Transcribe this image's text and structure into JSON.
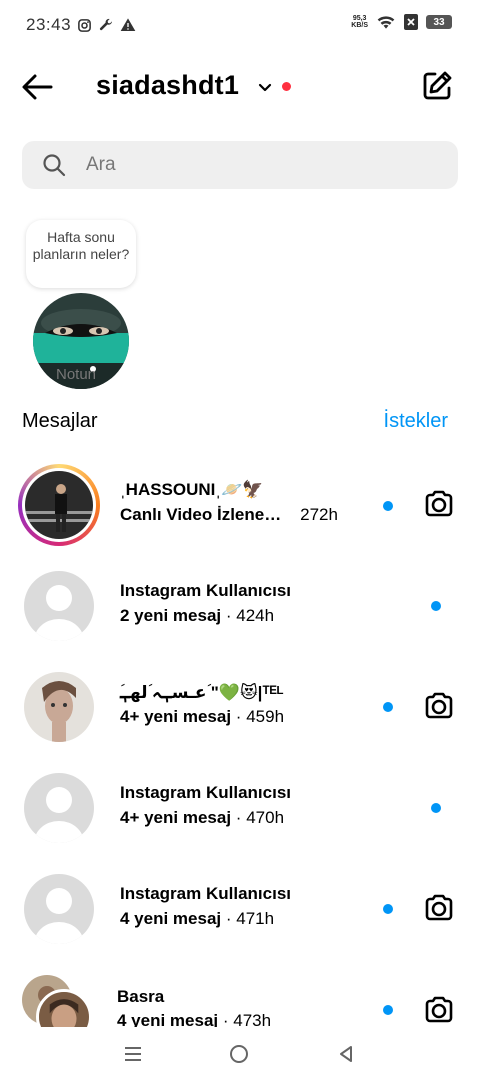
{
  "status_bar": {
    "time": "23:43",
    "net_speed_value": "95,3",
    "net_speed_unit": "KB/S",
    "battery": "33"
  },
  "header": {
    "username": "siadashdt1"
  },
  "search": {
    "placeholder": "Ara"
  },
  "note": {
    "bubble_text": "Hafta sonu planların neler?",
    "label": "Notun"
  },
  "section": {
    "title": "Mesajlar",
    "requests_label": "İstekler"
  },
  "threads": [
    {
      "name": "ˌHASSOUNIˌ🪐🦅",
      "preview": "Canlı Video İzlene…",
      "time": "272h"
    },
    {
      "name": "Instagram Kullanıcısı",
      "preview": "2 yeni mesaj",
      "time": "424h"
    },
    {
      "name": "ؘعـسـٖہ ؘلهـٖ ؘ\"💚😻|ᵀᴱᴸ",
      "preview": "4+ yeni mesaj",
      "time": "459h"
    },
    {
      "name": "Instagram Kullanıcısı",
      "preview": "4+ yeni mesaj",
      "time": "470h"
    },
    {
      "name": "Instagram Kullanıcısı",
      "preview": "4 yeni mesaj",
      "time": "471h"
    },
    {
      "name": "Basra",
      "preview": "4 yeni mesaj",
      "time": "473h"
    }
  ],
  "separator": "·",
  "colors": {
    "accent_blue": "#0095f6",
    "notification_red": "#ff3040",
    "story_ring": [
      "#feda75",
      "#fa7e1e",
      "#d62976",
      "#962fbf"
    ]
  },
  "icons": {
    "back": "arrow-left-icon",
    "compose": "pencil-square-icon",
    "search": "search-icon",
    "camera": "camera-icon"
  }
}
